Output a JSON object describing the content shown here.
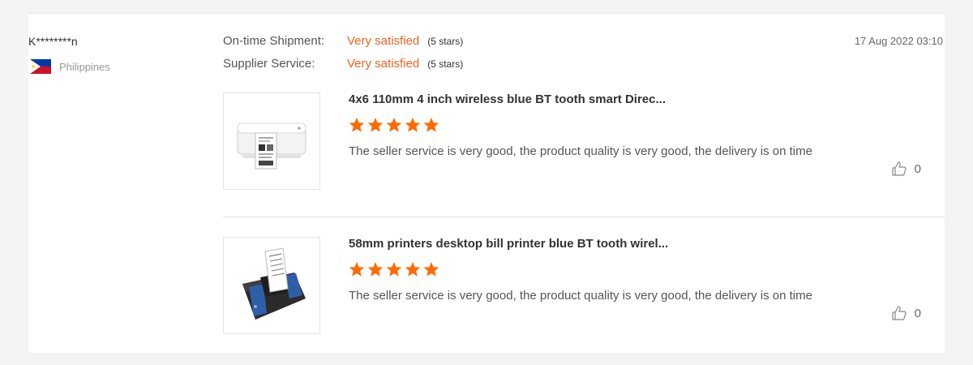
{
  "review": {
    "reviewer_name": "K********n",
    "country": "Philippines",
    "date": "17 Aug 2022 03:10",
    "ratings": [
      {
        "label": "On-time Shipment:",
        "value": "Very satisfied",
        "stars_text": "(5 stars)"
      },
      {
        "label": "Supplier Service:",
        "value": "Very satisfied",
        "stars_text": "(5 stars)"
      }
    ],
    "items": [
      {
        "title": "4x6 110mm 4 inch wireless blue BT tooth smart Direc...",
        "rating": 5,
        "comment": "The seller service is very good, the product quality is very good, the delivery is on time",
        "likes": "0"
      },
      {
        "title": "58mm printers desktop bill printer blue BT tooth wirel...",
        "rating": 5,
        "comment": "The seller service is very good, the product quality is very good, the delivery is on time",
        "likes": "0"
      }
    ]
  },
  "colors": {
    "accent": "#f0641e",
    "star": "#ff6a00"
  },
  "icons": {
    "flag": "philippines-flag-icon",
    "like": "thumbs-up-icon",
    "rating": "star-icon"
  }
}
